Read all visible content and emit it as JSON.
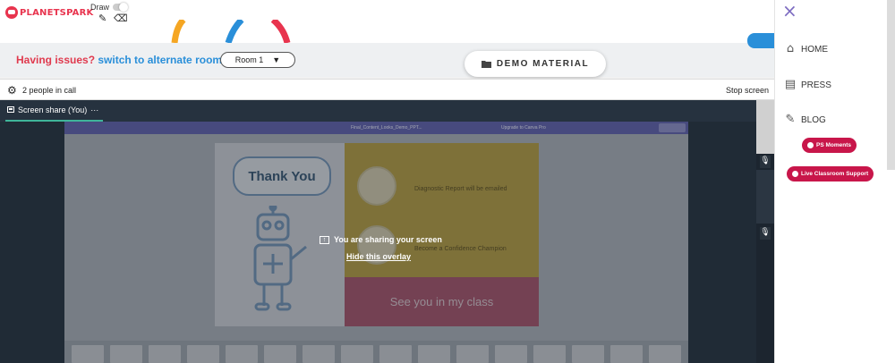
{
  "header": {
    "logo_text": "PLANETSPARK",
    "draw_label": "Draw",
    "pencil_icon": "pencil-icon",
    "eraser_icon": "eraser-icon"
  },
  "issues_bar": {
    "question": "Having issues?",
    "link": "switch to alternate room",
    "room_selected": "Room 1",
    "room_caret": "▼"
  },
  "demo_button": {
    "label": "DEMO MATERIAL",
    "icon": "folder-icon"
  },
  "call_bar": {
    "people": "2 people in call",
    "stop": "Stop screen"
  },
  "meeting": {
    "tab_label": "Screen share (You)",
    "tab_more": "···",
    "shared_window": {
      "file_name": "Final_Content_Looks_Demo_PPT...",
      "upgrade": "Upgrade to Canva Pro",
      "slide_title": "Thank You",
      "diagnostic": "Diagnostic Report will be emailed",
      "confidence": "Become a Confidence Champion",
      "see_you": "See you in my class"
    },
    "overlay_message": "You are sharing your screen",
    "overlay_link": "Hide this overlay"
  },
  "sidebar": {
    "close_icon": "×",
    "nav": [
      {
        "label": "HOME",
        "icon": "home-icon"
      },
      {
        "label": "PRESS",
        "icon": "newspaper-icon"
      },
      {
        "label": "BLOG",
        "icon": "pencil-icon"
      }
    ],
    "ps_moments": "PS Moments",
    "live_support": "Live Classroom Support"
  },
  "colors": {
    "brand_red": "#e8344e",
    "link_blue": "#2a8fd9",
    "pill_red": "#c8164a",
    "meeting_bg": "#202b36"
  }
}
